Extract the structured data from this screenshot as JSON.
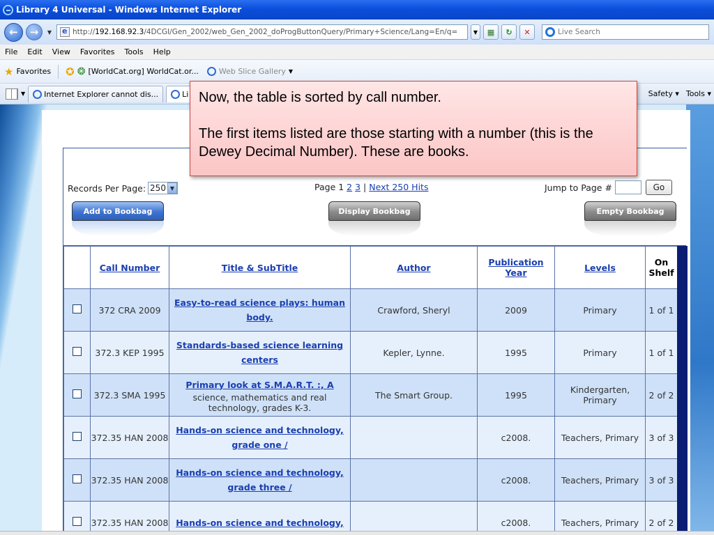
{
  "window": {
    "title": "Library 4 Universal - Windows Internet Explorer"
  },
  "address": {
    "url_prefix": "http://",
    "url_host": "192.168.92.3",
    "url_path": "/4DCGI/Gen_2002/web_Gen_2002_doProgButtonQuery/Primary+Science/Lang=En/q=",
    "search_placeholder": "Live Search"
  },
  "menu": [
    "File",
    "Edit",
    "View",
    "Favorites",
    "Tools",
    "Help"
  ],
  "favorites": {
    "label": "Favorites",
    "items": [
      "[WorldCat.org] WorldCat.or...",
      "Web Slice Gallery"
    ]
  },
  "tabs": {
    "items": [
      "Internet Explorer cannot dis...",
      "Li"
    ],
    "commands": [
      "Safety",
      "Tools"
    ]
  },
  "controls": {
    "records_label": "Records Per Page:",
    "records_value": "250",
    "page_label": "Page 1",
    "page_2": "2",
    "page_3": "3",
    "separator": "|",
    "next_hits": "Next 250 Hits",
    "jump_label": "Jump to Page #",
    "go": "Go",
    "add_bookbag": "Add to Bookbag",
    "display_bookbag": "Display Bookbag",
    "empty_bookbag": "Empty Bookbag"
  },
  "table": {
    "headers": {
      "call_number": "Call Number",
      "title": "Title & SubTitle",
      "author": "Author",
      "pub_line1": "Publication",
      "pub_line2": "Year",
      "levels": "Levels",
      "shelf_line1": "On",
      "shelf_line2": "Shelf"
    },
    "rows": [
      {
        "call": "372 CRA 2009",
        "title": "Easy-to-read science plays: human body.",
        "subtitle": "",
        "author": "Crawford, Sheryl",
        "year": "2009",
        "levels": "Primary",
        "shelf": "1 of 1"
      },
      {
        "call": "372.3 KEP 1995",
        "title": "Standards-based science learning centers",
        "subtitle": "",
        "author": "Kepler, Lynne.",
        "year": "1995",
        "levels": "Primary",
        "shelf": "1 of 1"
      },
      {
        "call": "372.3 SMA 1995",
        "title": "Primary look at S.M.A.R.T. :, A",
        "subtitle": "science, mathematics and real technology, grades K-3.",
        "author": "The Smart Group.",
        "year": "1995",
        "levels": "Kindergarten, Primary",
        "shelf": "2 of 2"
      },
      {
        "call": "372.35 HAN 2008",
        "title": "Hands-on science and technology, grade one /",
        "subtitle": "",
        "author": "",
        "year": "c2008.",
        "levels": "Teachers, Primary",
        "shelf": "3 of 3"
      },
      {
        "call": "372.35 HAN 2008",
        "title": "Hands-on science and technology, grade three /",
        "subtitle": "",
        "author": "",
        "year": "c2008.",
        "levels": "Teachers, Primary",
        "shelf": "3 of 3"
      },
      {
        "call": "372.35 HAN 2008",
        "title": "Hands-on science and technology,",
        "subtitle": "",
        "author": "",
        "year": "c2008.",
        "levels": "Teachers, Primary",
        "shelf": "2 of 2"
      }
    ]
  },
  "callout": {
    "line1": "Now, the table is sorted by call number.",
    "line2": "The first items listed are those starting with a number (this is the Dewey Decimal Number).   These are books."
  }
}
